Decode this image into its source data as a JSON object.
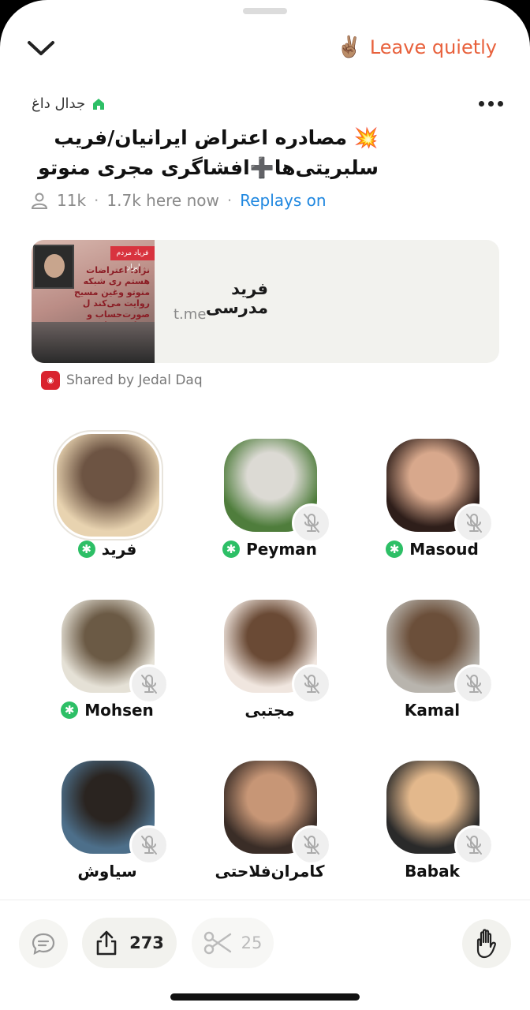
{
  "header": {
    "leave_label": "Leave quietly",
    "leave_emoji": "✌🏽"
  },
  "room": {
    "club_name": "جدال داغ",
    "title_line1": "💥 مصادره اعتراض ایرانیان/فریب",
    "title_line2": "سلبریتی‌ها➕افشاگری مجری منوتو",
    "listeners": "11k",
    "here_now": "1.7k here now",
    "replays": "Replays on"
  },
  "link_card": {
    "name": "فرید مدرسی",
    "domain": "t.me",
    "thumb_badge": "فریاد مردم ایران",
    "thumb_text": "نژاد: اعتراضات هستم ری شبکه منوتو وغین مسیح روایت می‌کند ل صورت‌حساب و دریافت پول می‌شود"
  },
  "shared_by": "Shared by Jedal Daq",
  "speakers": [
    {
      "name": "فرید",
      "moderator": true,
      "muted": false,
      "active": true,
      "c1": "#e8d3b0",
      "c2": "#6d5443"
    },
    {
      "name": "Peyman",
      "moderator": true,
      "muted": true,
      "active": false,
      "c1": "#4f7d3c",
      "c2": "#dcdad4"
    },
    {
      "name": "Masoud",
      "moderator": true,
      "muted": true,
      "active": false,
      "c1": "#2e1e1a",
      "c2": "#d8a88c"
    },
    {
      "name": "Mohsen",
      "moderator": true,
      "muted": true,
      "active": false,
      "c1": "#e5e1d6",
      "c2": "#6b5a45"
    },
    {
      "name": "مجتبی",
      "moderator": false,
      "muted": true,
      "active": false,
      "c1": "#f0e6df",
      "c2": "#6a4a35"
    },
    {
      "name": "Kamal",
      "moderator": false,
      "muted": true,
      "active": false,
      "c1": "#b8b4ad",
      "c2": "#6b4f3a"
    },
    {
      "name": "سیاوش",
      "moderator": false,
      "muted": true,
      "active": false,
      "c1": "#4d6f8a",
      "c2": "#2a2420"
    },
    {
      "name": "کامران‌فلاحتی",
      "moderator": false,
      "muted": true,
      "active": false,
      "c1": "#3a2d27",
      "c2": "#c79676"
    },
    {
      "name": "Babak",
      "moderator": false,
      "muted": true,
      "active": false,
      "c1": "#2a2a2a",
      "c2": "#e3b88c"
    }
  ],
  "bottom_bar": {
    "share_count": "273",
    "clip_count": "25"
  },
  "icons": {
    "back": "chevron-down-icon",
    "more": "more-dots-icon",
    "club": "house-icon",
    "listeners": "person-icon",
    "mute": "mic-off-icon",
    "moderator": "moderator-star-icon",
    "chat": "chat-icon",
    "share": "share-icon",
    "clip": "scissors-icon",
    "hand": "raise-hand-icon"
  },
  "colors": {
    "accent": "#e8613c",
    "link": "#1f87e0",
    "moderator": "#2dbf66"
  }
}
